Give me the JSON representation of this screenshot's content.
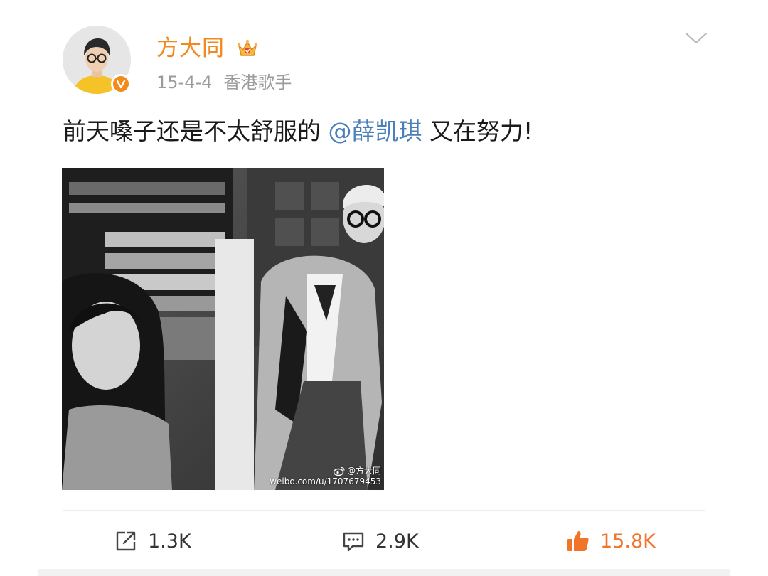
{
  "author": {
    "name": "方大同",
    "avatar_icon": "avatar-image",
    "verified_icon": "verified-v-icon",
    "crown_icon": "member-crown-icon"
  },
  "meta": {
    "date": "15-4-4",
    "source": "香港歌手"
  },
  "post": {
    "text_before": "前天嗓子还是不太舒服的 ",
    "mention": "@薛凯琪",
    "text_after": " 又在努力!"
  },
  "photo": {
    "watermark_handle": "@方大同",
    "watermark_url": "weibo.com/u/1707679453"
  },
  "actions": {
    "repost_count": "1.3K",
    "comment_count": "2.9K",
    "like_count": "15.8K"
  },
  "colors": {
    "accent_orange": "#f08a1e",
    "mention_blue": "#4b7fb8",
    "like_orange": "#f0752b",
    "meta_gray": "#9b9b9b"
  }
}
